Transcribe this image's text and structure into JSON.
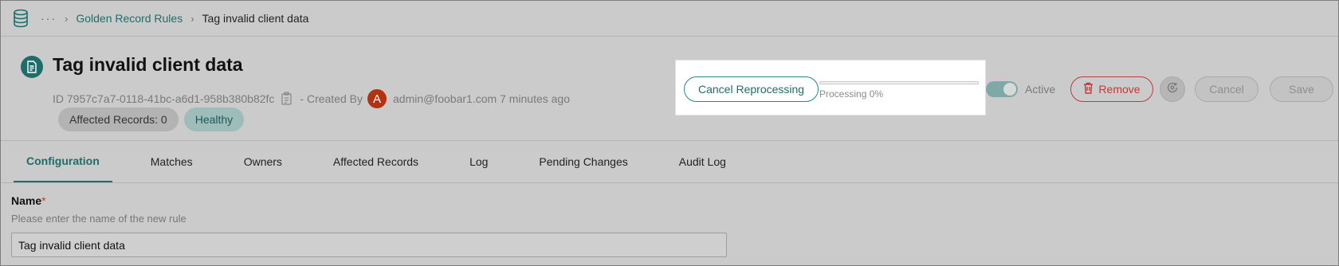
{
  "breadcrumb": {
    "ellipsis": "···",
    "parent": "Golden Record Rules",
    "current": "Tag invalid client data"
  },
  "header": {
    "title": "Tag invalid client data",
    "id_label": "ID",
    "id_value": "7957c7a7-0118-41bc-a6d1-958b380b82fc",
    "created_by_label": "- Created By",
    "avatar_letter": "A",
    "creator": "admin@foobar1.com",
    "created_ago": "7 minutes ago",
    "chips": {
      "affected": "Affected Records: 0",
      "health": "Healthy"
    }
  },
  "processing": {
    "cancel_label": "Cancel Reprocessing",
    "progress_text": "Processing 0%",
    "progress_fraction": 0
  },
  "actions": {
    "active_label": "Active",
    "active_on": true,
    "remove_label": "Remove",
    "cancel_label": "Cancel",
    "save_label": "Save"
  },
  "tabs": [
    {
      "label": "Configuration",
      "active": true
    },
    {
      "label": "Matches"
    },
    {
      "label": "Owners"
    },
    {
      "label": "Affected Records"
    },
    {
      "label": "Log"
    },
    {
      "label": "Pending Changes"
    },
    {
      "label": "Audit Log"
    }
  ],
  "form": {
    "name_label": "Name",
    "required_mark": "*",
    "name_help": "Please enter the name of the new rule",
    "name_value": "Tag invalid client data"
  },
  "colors": {
    "accent": "#1d6e6a",
    "danger": "#c23a3a",
    "avatar": "#b3320f"
  },
  "icons": [
    "database-icon",
    "chevron-right-icon",
    "document-icon",
    "copy-icon",
    "trash-icon",
    "reprocess-icon"
  ]
}
